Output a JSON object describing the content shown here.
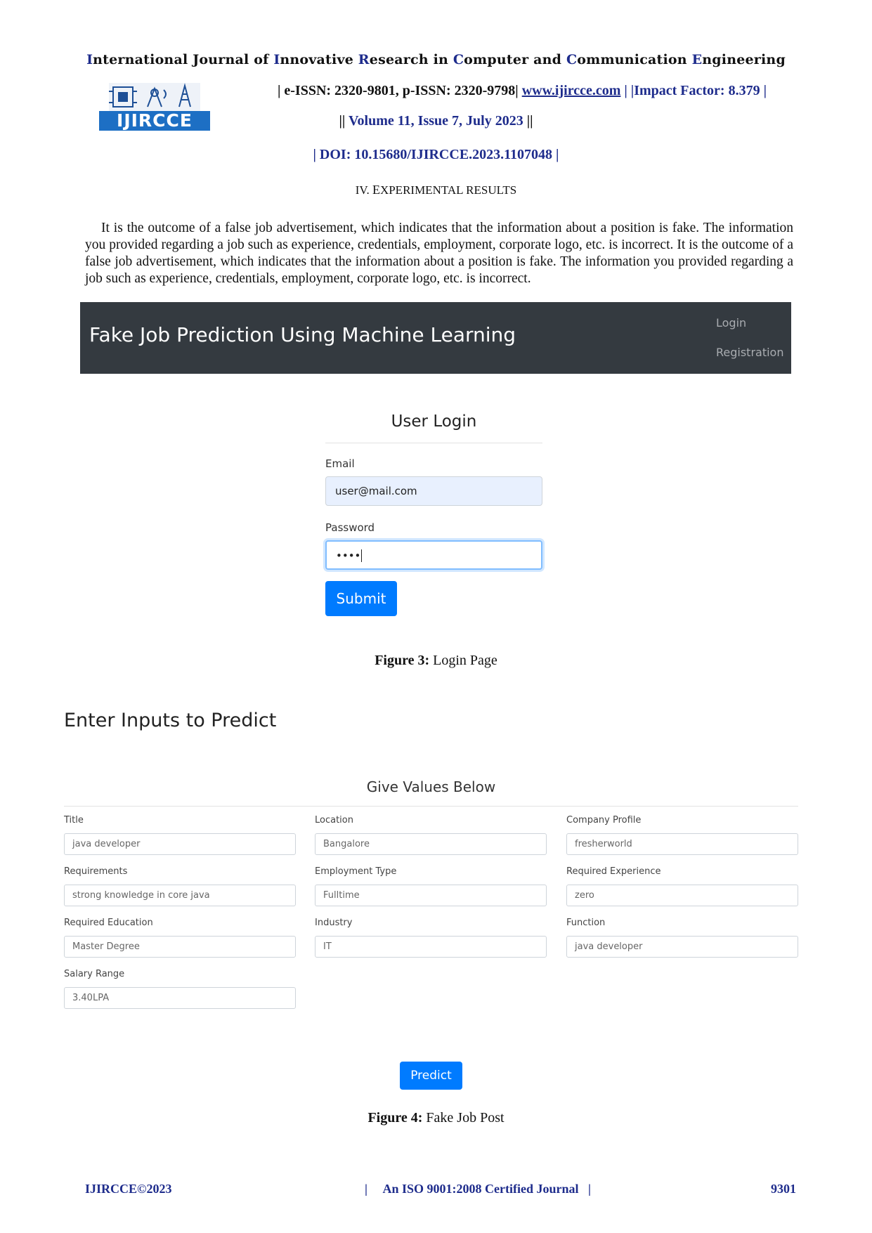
{
  "journal": {
    "title_parts": [
      {
        "cap": "I",
        "rest": "nternational "
      },
      {
        "cap": "",
        "rest": "Journal of "
      },
      {
        "cap": "I",
        "rest": "nnovative "
      },
      {
        "cap": "R",
        "rest": "esearch in "
      },
      {
        "cap": "C",
        "rest": "omputer and "
      },
      {
        "cap": "C",
        "rest": "ommunication "
      },
      {
        "cap": "E",
        "rest": "ngineering"
      }
    ],
    "logo_text": "IJIRCCE",
    "issn_text": "| e-ISSN: 2320-9801, p-ISSN: 2320-9798| ",
    "website": "www.ijircce.com",
    "impact": " | |Impact Factor: 8.379 |",
    "volume_prefix": "|| ",
    "volume": "Volume 11, Issue 7, July 2023",
    "volume_suffix": " ||",
    "doi": "| DOI: 10.15680/IJIRCCE.2023.1107048 |"
  },
  "section": {
    "number": "IV. ",
    "first_letter": "E",
    "rest": "XPERIMENTAL RESULTS"
  },
  "paragraph": "It is the outcome of a false job advertisement, which indicates that the information about a position is fake. The information you provided regarding a job such as experience, credentials, employment, corporate logo, etc. is incorrect. It is the outcome of a false job advertisement, which indicates that the information about a position is fake. The information you provided regarding a job such as experience, credentials, employment, corporate logo, etc. is incorrect.",
  "figure3": {
    "navbar": {
      "brand": "Fake Job Prediction Using Machine Learning",
      "login": "Login",
      "registration": "Registration"
    },
    "login": {
      "heading": "User Login",
      "email_label": "Email",
      "email_value": "user@mail.com",
      "password_label": "Password",
      "password_value": "••••",
      "submit_label": "Submit"
    },
    "caption_label": "Figure 3:",
    "caption_text": " Login Page"
  },
  "figure4": {
    "title": "Enter Inputs to Predict",
    "subtitle": "Give Values Below",
    "fields": [
      {
        "label": "Title",
        "value": "java developer"
      },
      {
        "label": "Location",
        "value": "Bangalore"
      },
      {
        "label": "Company Profile",
        "value": "fresherworld"
      },
      {
        "label": "Requirements",
        "value": "strong knowledge in core java"
      },
      {
        "label": "Employment Type",
        "value": "Fulltime"
      },
      {
        "label": "Required Experience",
        "value": "zero"
      },
      {
        "label": "Required Education",
        "value": "Master Degree"
      },
      {
        "label": "Industry",
        "value": "IT"
      },
      {
        "label": "Function",
        "value": "java developer"
      },
      {
        "label": "Salary Range",
        "value": "3.40LPA"
      }
    ],
    "predict_label": "Predict",
    "caption_label": "Figure 4:",
    "caption_text": " Fake Job Post"
  },
  "footer": {
    "left": "IJIRCCE©2023",
    "center": "|     An ISO 9001:2008 Certified Journal   |",
    "right": "9301"
  }
}
